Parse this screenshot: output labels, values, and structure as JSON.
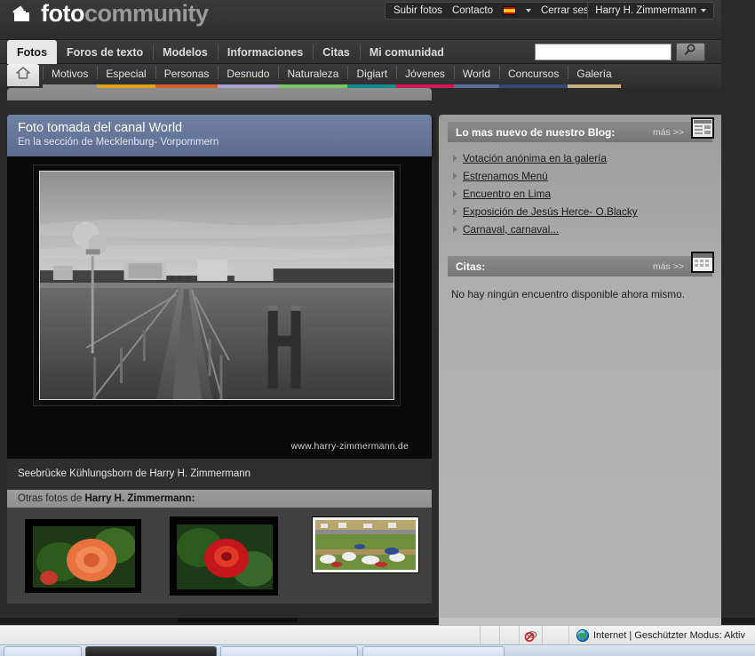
{
  "site": {
    "logo_foto": "foto",
    "logo_community": "community",
    "logo_icon": "camera-photos-icon"
  },
  "topnav": {
    "items": [
      {
        "label": "Subir fotos",
        "name": "upload-photos-link"
      },
      {
        "label": "Contacto",
        "name": "contact-link"
      }
    ],
    "language_flag": "spain-flag-icon",
    "logout_label": "Cerrar sesión",
    "user_name": "Harry H. Zimmermann"
  },
  "tabs": [
    {
      "label": "Fotos",
      "active": true
    },
    {
      "label": "Foros de texto",
      "active": false
    },
    {
      "label": "Modelos",
      "active": false
    },
    {
      "label": "Informaciones",
      "active": false
    },
    {
      "label": "Citas",
      "active": false
    },
    {
      "label": "Mi comunidad",
      "active": false
    }
  ],
  "search": {
    "value": "",
    "placeholder": "",
    "button_icon": "magnifier-icon"
  },
  "subnav": {
    "home_icon": "home-icon",
    "items": [
      {
        "label": "Motivos",
        "color": "#8e8e8e"
      },
      {
        "label": "Especial",
        "color": "#e0a020"
      },
      {
        "label": "Personas",
        "color": "#d4622a"
      },
      {
        "label": "Desnudo",
        "color": "#a99ec9"
      },
      {
        "label": "Naturaleza",
        "color": "#7dc463"
      },
      {
        "label": "Digiart",
        "color": "#0f8b8b"
      },
      {
        "label": "Jóvenes",
        "color": "#d01a54"
      },
      {
        "label": "World",
        "color": "#5b6d92"
      },
      {
        "label": "Concursos",
        "color": "#3c4672"
      },
      {
        "label": "Galería",
        "color": "#c9b07f"
      }
    ]
  },
  "photo": {
    "title": "Foto tomada del canal World",
    "subtitle": "En la sección de Mecklenburg- Vorpommern",
    "watermark": "www.harry-zimmermann.de",
    "caption": "Seebrücke Kühlungsborn de Harry H. Zimmermann",
    "alt": "black-and-white-photo-of-pier-seebruecke-kuehlungsborn"
  },
  "others": {
    "prefix": "Otras fotos de ",
    "author": "Harry H. Zimmermann:",
    "thumbnails": [
      {
        "name": "thumbnail-orange-rose"
      },
      {
        "name": "thumbnail-red-rose"
      },
      {
        "name": "thumbnail-market-field"
      }
    ]
  },
  "blog_panel": {
    "title": "Lo mas nuevo de nuestro Blog:",
    "more_label": "más >>",
    "icon": "newspaper-icon",
    "links": [
      "Votación anónima en la galería",
      "Estrenamos Menú",
      "Encuentro en Lima",
      "Exposición de Jesús Herce- O.Blacky",
      "Carnaval, carnaval..."
    ]
  },
  "dates_panel": {
    "title": "Citas:",
    "more_label": "más >>",
    "icon": "calendar-icon",
    "text": "No hay ningún encuentro disponible ahora mismo."
  },
  "statusbar": {
    "blocked_icon": "popup-blocked-icon",
    "zone_icon": "internet-globe-icon",
    "zone_text": "Internet | Geschützter Modus: Aktiv"
  },
  "theme": {
    "page_bg": "#2b2b2b",
    "header_bg": "#343434",
    "accent_blue": "#5c6c90",
    "panel_gray": "#aeaeae"
  }
}
